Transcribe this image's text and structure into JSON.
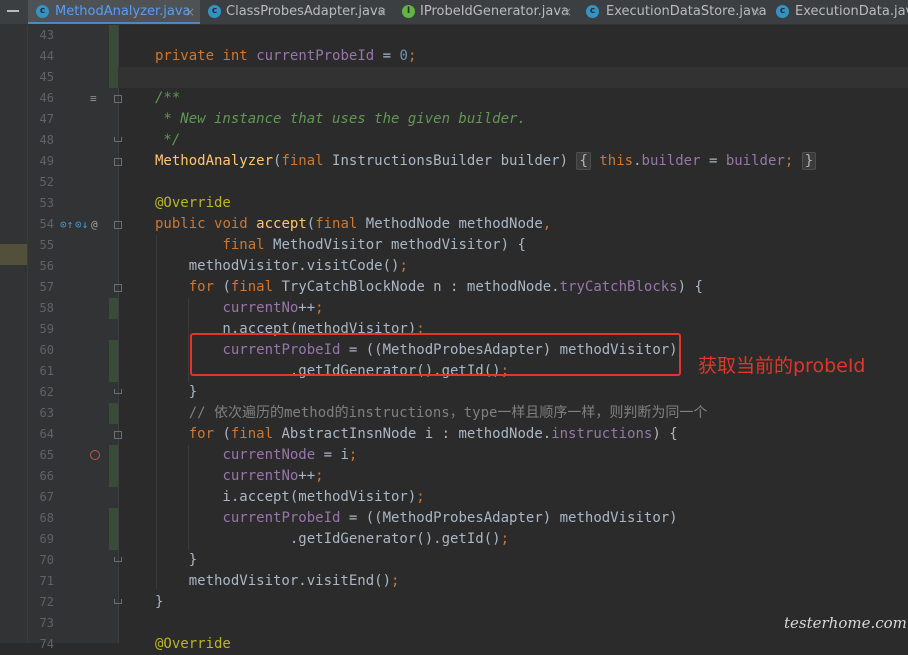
{
  "tabs": [
    {
      "label": "MethodAnalyzer.java",
      "icon": "class-c-icon",
      "active": true
    },
    {
      "label": "ClassProbesAdapter.java",
      "icon": "class-c-icon"
    },
    {
      "label": "IProbeIdGenerator.java",
      "icon": "interface-i-icon"
    },
    {
      "label": "ExecutionDataStore.java",
      "icon": "class-c-icon"
    },
    {
      "label": "ExecutionData.java",
      "icon": "class-c-icon"
    }
  ],
  "tab_icon_letters": {
    "class": "c",
    "interface": "I"
  },
  "tab_close": "×",
  "lines": [
    {
      "n": "43",
      "code": ""
    },
    {
      "n": "44",
      "code": "private int currentProbeId = 0;"
    },
    {
      "n": "45",
      "code": ""
    },
    {
      "n": "46",
      "code": "/**"
    },
    {
      "n": "47",
      "code": " * New instance that uses the given builder."
    },
    {
      "n": "48",
      "code": " */"
    },
    {
      "n": "49",
      "code": "MethodAnalyzer(final InstructionsBuilder builder) { this.builder = builder; }"
    },
    {
      "n": "52",
      "code": ""
    },
    {
      "n": "53",
      "code": "@Override"
    },
    {
      "n": "54",
      "code": "public void accept(final MethodNode methodNode,"
    },
    {
      "n": "55",
      "code": "        final MethodVisitor methodVisitor) {"
    },
    {
      "n": "56",
      "code": "    methodVisitor.visitCode();"
    },
    {
      "n": "57",
      "code": "    for (final TryCatchBlockNode n : methodNode.tryCatchBlocks) {"
    },
    {
      "n": "58",
      "code": "        currentNo++;"
    },
    {
      "n": "59",
      "code": "        n.accept(methodVisitor);"
    },
    {
      "n": "60",
      "code": "        currentProbeId = ((MethodProbesAdapter) methodVisitor)"
    },
    {
      "n": "61",
      "code": "                .getIdGenerator().getId();"
    },
    {
      "n": "62",
      "code": "    }"
    },
    {
      "n": "63",
      "code": "    // 依次遍历的method的instructions，type一样且顺序一样，则判断为同一个"
    },
    {
      "n": "64",
      "code": "    for (final AbstractInsnNode i : methodNode.instructions) {"
    },
    {
      "n": "65",
      "code": "        currentNode = i;"
    },
    {
      "n": "66",
      "code": "        currentNo++;"
    },
    {
      "n": "67",
      "code": "        i.accept(methodVisitor);"
    },
    {
      "n": "68",
      "code": "        currentProbeId = ((MethodProbesAdapter) methodVisitor)"
    },
    {
      "n": "69",
      "code": "                .getIdGenerator().getId();"
    },
    {
      "n": "70",
      "code": "    }"
    },
    {
      "n": "71",
      "code": "    methodVisitor.visitEnd();"
    },
    {
      "n": "72",
      "code": "}"
    },
    {
      "n": "73",
      "code": ""
    },
    {
      "n": "74",
      "code": "@Override"
    }
  ],
  "annotation_text": "获取当前的probeId",
  "watermark": "testerhome.com",
  "gutter_icons": {
    "line54": [
      "override-up-icon",
      "implemented-down-icon",
      "annotation-at-icon"
    ],
    "line54_glyphs": [
      "⊙↑",
      "⊙↓",
      "@"
    ],
    "line65": "breakpoint-hollow-icon",
    "line46": "javadoc-render-icon"
  },
  "colors": {
    "background": "#2b2b2b",
    "keyword": "#cc7832",
    "field": "#9876aa",
    "method_decl": "#ffc66d",
    "number": "#6897bb",
    "doc_comment": "#629755",
    "annotation": "#bbb529",
    "line_comment": "#808080",
    "highlight_box": "#e3352a",
    "active_tab": "#589df6"
  }
}
